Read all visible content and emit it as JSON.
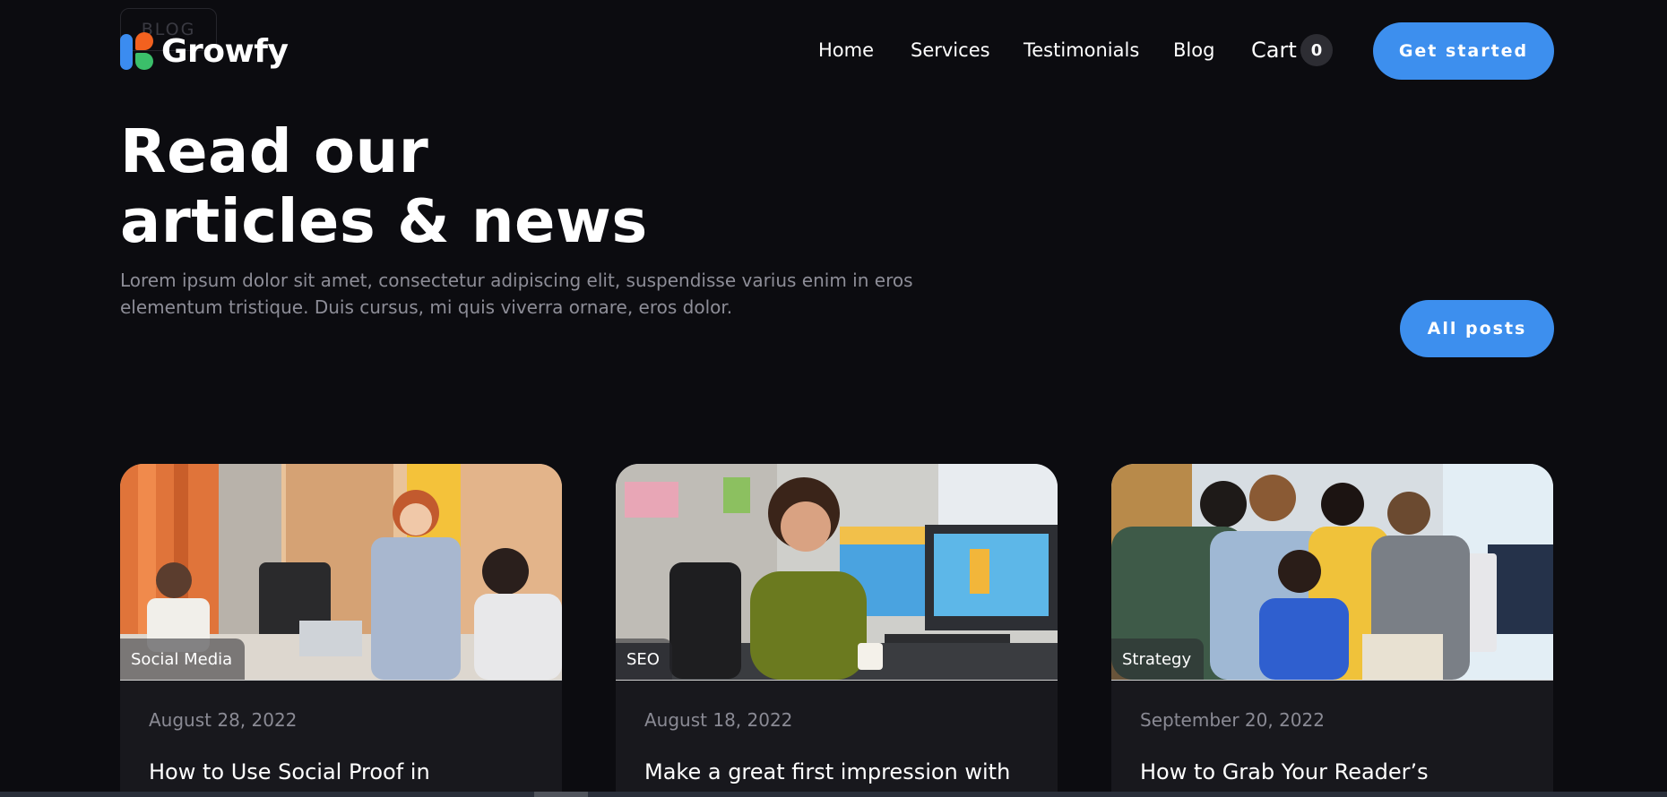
{
  "badge": {
    "label": "BLOG"
  },
  "header": {
    "brand": "Growfy",
    "nav": [
      "Home",
      "Services",
      "Testimonials",
      "Blog"
    ],
    "cart_label": "Cart",
    "cart_count": "0",
    "cta_label": "Get started"
  },
  "hero": {
    "title_line1": "Read our",
    "title_line2": "articles & news",
    "description": "Lorem ipsum dolor sit amet, consectetur adipiscing elit, suspendisse varius enim in eros elementum tristique. Duis cursus, mi quis viverra ornare, eros dolor.",
    "all_posts_label": "All posts"
  },
  "posts": [
    {
      "category": "Social Media",
      "date": "August 28, 2022",
      "title": "How to Use Social Proof in"
    },
    {
      "category": "SEO",
      "date": "August 18, 2022",
      "title": "Make a great first impression with"
    },
    {
      "category": "Strategy",
      "date": "September 20, 2022",
      "title": "How to Grab Your Reader’s"
    }
  ],
  "colors": {
    "background": "#0c0c10",
    "accent": "#3d8fee",
    "card_bg": "#18181d",
    "logo_blue": "#3b8cf0",
    "logo_orange": "#f2611f",
    "logo_green": "#3bbf6a"
  }
}
